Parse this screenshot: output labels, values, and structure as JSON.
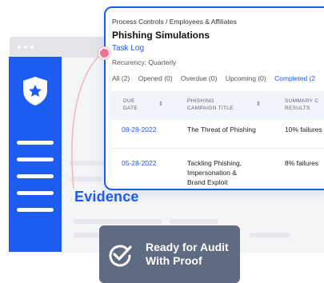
{
  "colors": {
    "accent": "#1d5cf0",
    "link_dot": "#f47195",
    "badge_bg": "#5f6b80"
  },
  "background_window": {
    "sidebar_icon": "shield-star-icon"
  },
  "card": {
    "breadcrumb": "Process Controls / Employees & Affiliates",
    "title": "Phishing Simulations",
    "task_log": "Task Log",
    "recurrency": "Recurency: Quarterly",
    "tabs": [
      {
        "label": "All (2)"
      },
      {
        "label": "Opened (0)"
      },
      {
        "label": "Overdue (0)"
      },
      {
        "label": "Upcoming (0)"
      },
      {
        "label": "Completed (2"
      }
    ],
    "table": {
      "headers": [
        {
          "line1": "DUE",
          "line2": "DATE"
        },
        {
          "line1": "PHISHING",
          "line2": "CAMPAIGN TITLE"
        },
        {
          "line1": "SUMMARY C",
          "line2": "RESULTS"
        }
      ],
      "rows": [
        {
          "due_date": "08-28-2022",
          "title": "The Threat of Phishing",
          "summary": "10% failures"
        },
        {
          "due_date": "05-28-2022",
          "title_lines": [
            "Tackling Phishing,",
            "Impersonation &",
            "Brand Exploit"
          ],
          "summary": "8% failures"
        }
      ]
    }
  },
  "evidence_label": "Evidence",
  "badge": {
    "icon": "check-circle-icon",
    "line1": "Ready for Audit",
    "line2": "With Proof"
  }
}
